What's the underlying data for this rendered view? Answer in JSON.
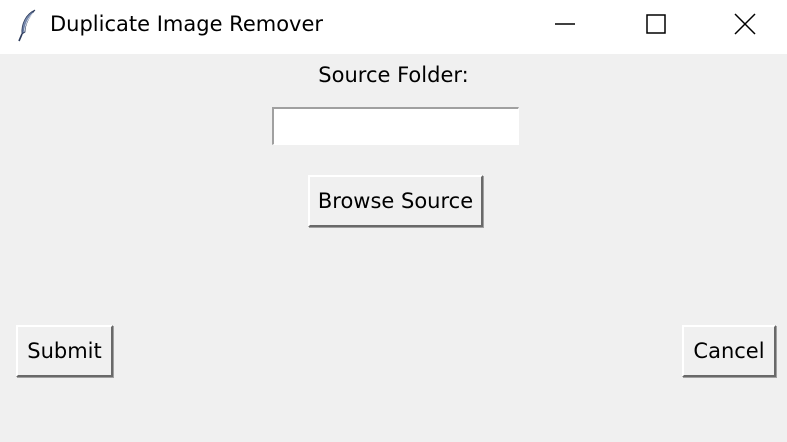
{
  "window": {
    "title": "Duplicate Image Remover",
    "app_icon": "feather-icon",
    "controls": {
      "minimize_icon": "minimize-icon",
      "maximize_icon": "maximize-icon",
      "close_icon": "close-icon"
    }
  },
  "form": {
    "source_label": "Source Folder:",
    "source_value": "",
    "browse_label": "Browse Source"
  },
  "actions": {
    "submit_label": "Submit",
    "cancel_label": "Cancel"
  },
  "colors": {
    "background": "#f0f0f0",
    "titlebar": "#ffffff",
    "text": "#000000"
  }
}
